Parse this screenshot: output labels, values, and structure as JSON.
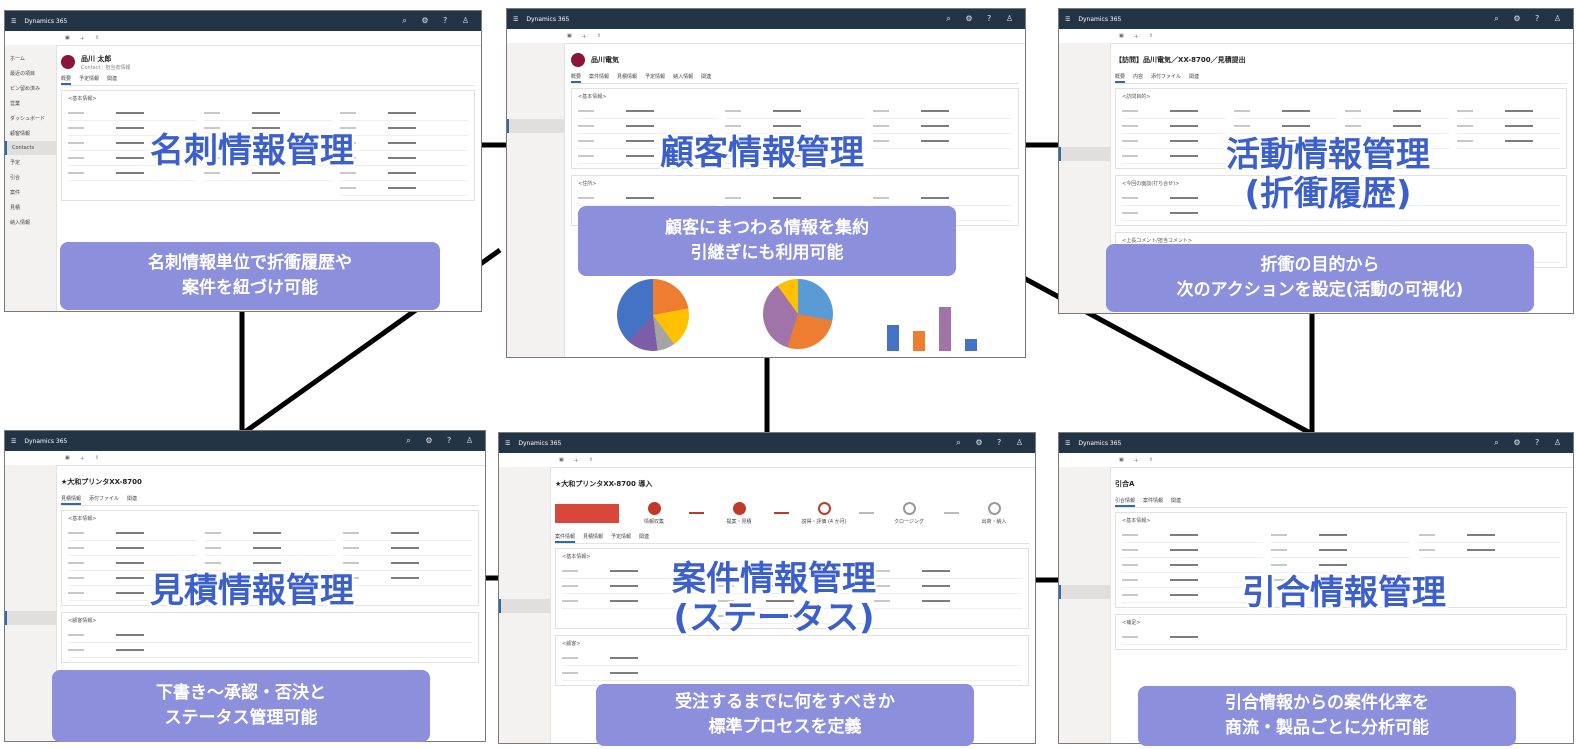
{
  "modules": {
    "meishi": {
      "title": "名刺情報管理",
      "desc": [
        "名刺情報単位で折衝履歴や",
        "案件を紐づけ可能"
      ],
      "screen": {
        "app": "Dynamics 365",
        "record_name": "品川 太郎",
        "record_type": "Contact : 担当者情報",
        "tabs": [
          "概要",
          "予定情報",
          "関連"
        ],
        "section": "<基本情報>",
        "nav": [
          "ホーム",
          "最近の項目",
          "ピン留め済み",
          "営業",
          "ダッシュボード",
          "顧客情報",
          "Contacts",
          "予定",
          "引合",
          "案件",
          "見積",
          "納入情報"
        ]
      }
    },
    "kokyaku": {
      "title": "顧客情報管理",
      "desc": [
        "顧客にまつわる情報を集約",
        "引継ぎにも利用可能"
      ],
      "screen": {
        "app": "Dynamics 365",
        "record_name": "品川電気",
        "tabs": [
          "概要",
          "案件情報",
          "見積情報",
          "予定情報",
          "納入情報",
          "関連"
        ],
        "section": "<基本情報>",
        "section2": "<住所>"
      }
    },
    "katsudo": {
      "title": "活動情報管理",
      "title2": "(折衝履歴)",
      "desc": [
        "折衝の目的から",
        "次のアクションを設定(活動の可視化)"
      ],
      "screen": {
        "app": "Dynamics 365",
        "record_name": "【訪問】品川電気／XX-8700／見積提出",
        "tabs": [
          "概要",
          "内容",
          "添付ファイル",
          "関連"
        ],
        "section": "<訪問目的>",
        "section2": "<今回の面談(打ち合せ)>",
        "section3": "<上長コメント/担当コメント>"
      }
    },
    "mitsumori": {
      "title": "見積情報管理",
      "desc": [
        "下書き～承認・否決と",
        "ステータス管理可能"
      ],
      "screen": {
        "app": "Dynamics 365",
        "record_name": "★大和プリンタXX-8700",
        "tabs": [
          "見積情報",
          "添付ファイル",
          "関連"
        ],
        "section": "<基本情報>",
        "section2": "<顧客情報>"
      }
    },
    "anken": {
      "title": "案件情報管理",
      "title2": "(ステータス)",
      "desc": [
        "受注するまでに何をすべきか",
        "標準プロセスを定義"
      ],
      "screen": {
        "app": "Dynamics 365",
        "record_name": "★大和プリンタXX-8700 導入",
        "tabs": [
          "案件情報",
          "見積情報",
          "予定情報",
          "関連"
        ],
        "section": "<基本情報>",
        "section2": "<顧客>",
        "stages": [
          "情報収集",
          "提案・見積",
          "説得・評価 (4 か月)",
          "クロージング",
          "出荷・納入"
        ]
      }
    },
    "hikiai": {
      "title": "引合情報管理",
      "desc": [
        "引合情報からの案件化率を",
        "商流・製品ごとに分析可能"
      ],
      "screen": {
        "app": "Dynamics 365",
        "record_name": "引合A",
        "tabs": [
          "引合情報",
          "案件情報",
          "関連"
        ],
        "section": "<基本情報>",
        "section2": "<補足>"
      }
    }
  },
  "colors": {
    "title": "#3b5fcb",
    "callout": "#8b8fdc",
    "topbar": "#243447",
    "line": "#000000"
  }
}
